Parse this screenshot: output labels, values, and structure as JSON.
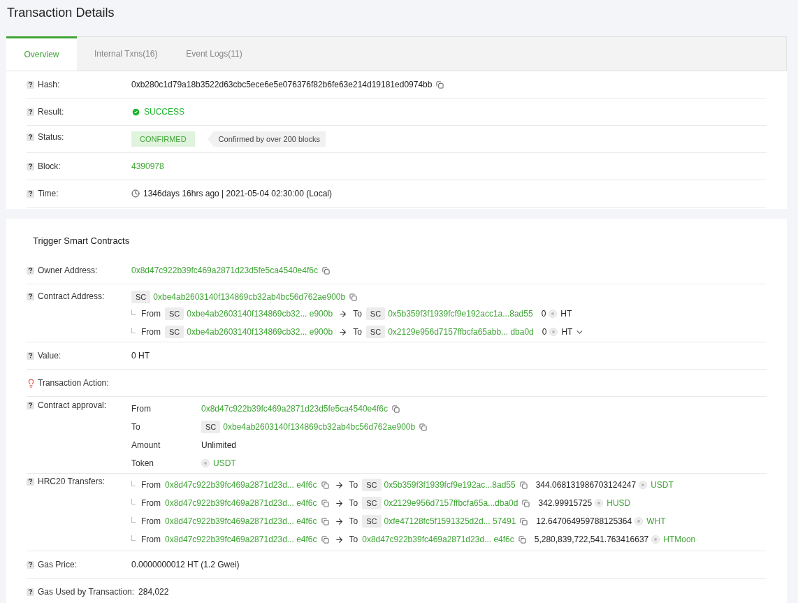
{
  "title": "Transaction Details",
  "tabs": [
    {
      "label": "Overview",
      "selected": true
    },
    {
      "label": "Internal Txns(16)",
      "selected": false
    },
    {
      "label": "Event Logs(11)",
      "selected": false
    }
  ],
  "overview": [
    {
      "kind": "hash",
      "label": "Hash:",
      "value": "0xb280c1d79a18b3522d63cbc5ece6e5e076376f82b6fe63e214d19181ed0974bb"
    },
    {
      "kind": "result",
      "label": "Result:",
      "value": "SUCCESS"
    },
    {
      "kind": "status",
      "label": "Status:",
      "value": "CONFIRMED",
      "note": "Confirmed by over 200 blocks"
    },
    {
      "kind": "link",
      "label": "Block:",
      "value": "4390978"
    },
    {
      "kind": "time",
      "label": "Time:",
      "value": "1346days 16hrs ago | 2021-05-04 02:30:00 (Local)"
    }
  ],
  "contract": {
    "title": "Trigger Smart Contracts",
    "rows": [
      {
        "kind": "address",
        "label": "Owner Address:",
        "value": "0x8d47c922b39fc469a2871d23d5fe5ca4540e4f6c"
      },
      {
        "kind": "contract",
        "label": "Contract Address:",
        "badge": "SC",
        "value": "0xbe4ab2603140f134869cb32ab4bc56d762ae900b",
        "internal": [
          {
            "from_label": "From",
            "from_badge": "SC",
            "from": "0xbe4ab2603140f134869cb32... e900b",
            "to_label": "To",
            "to_badge": "SC",
            "to": "0x5b359f3f1939fcf9e192acc1a...8ad55",
            "amount": "0",
            "token": "HT",
            "expandable": false
          },
          {
            "from_label": "From",
            "from_badge": "SC",
            "from": "0xbe4ab2603140f134869cb32... e900b",
            "to_label": "To",
            "to_badge": "SC",
            "to": "0x2129e956d7157ffbcfa65abb... dba0d",
            "amount": "0",
            "token": "HT",
            "expandable": true
          }
        ]
      },
      {
        "kind": "plain",
        "label": "Value:",
        "value": "0 HT"
      },
      {
        "kind": "action",
        "label": "Transaction Action:"
      },
      {
        "kind": "approval",
        "label": "Contract approval:",
        "items": [
          {
            "kind": "address",
            "label": "From",
            "value": "0x8d47c922b39fc469a2871d23d5fe5ca4540e4f6c"
          },
          {
            "kind": "contract",
            "label": "To",
            "badge": "SC",
            "value": "0xbe4ab2603140f134869cb32ab4bc56d762ae900b"
          },
          {
            "kind": "plain",
            "label": "Amount",
            "value": "Unlimited"
          },
          {
            "kind": "token",
            "label": "Token",
            "value": "USDT"
          }
        ]
      },
      {
        "kind": "transfers",
        "label": "HRC20 Transfers:",
        "transfers": [
          {
            "from_label": "From",
            "from": "0x8d47c922b39fc469a2871d23d... e4f6c",
            "to_label": "To",
            "to_badge": "SC",
            "to": "0x5b359f3f1939fcf9e192ac...8ad55",
            "amount": "344.068131986703124247",
            "token": "USDT"
          },
          {
            "from_label": "From",
            "from": "0x8d47c922b39fc469a2871d23d... e4f6c",
            "to_label": "To",
            "to_badge": "SC",
            "to": "0x2129e956d7157ffbcfa65a...dba0d",
            "amount": "342.99915725",
            "token": "HUSD"
          },
          {
            "from_label": "From",
            "from": "0x8d47c922b39fc469a2871d23d... e4f6c",
            "to_label": "To",
            "to_badge": "SC",
            "to": "0xfe47128fc5f1591325d2d... 57491",
            "amount": "12.647064959788125364",
            "token": "WHT"
          },
          {
            "from_label": "From",
            "from": "0x8d47c922b39fc469a2871d23d... e4f6c",
            "to_label": "To",
            "to": "0x8d47c922b39fc469a2871d23d... e4f6c",
            "amount": "5,280,839,722,541.763416637",
            "token": "HTMoon"
          }
        ]
      },
      {
        "kind": "plain",
        "label": "Gas Price:",
        "value": "0.0000000012 HT (1.2 Gwei)"
      },
      {
        "kind": "plain",
        "label": "Gas Used by Transaction:",
        "value": "284,022"
      }
    ]
  }
}
